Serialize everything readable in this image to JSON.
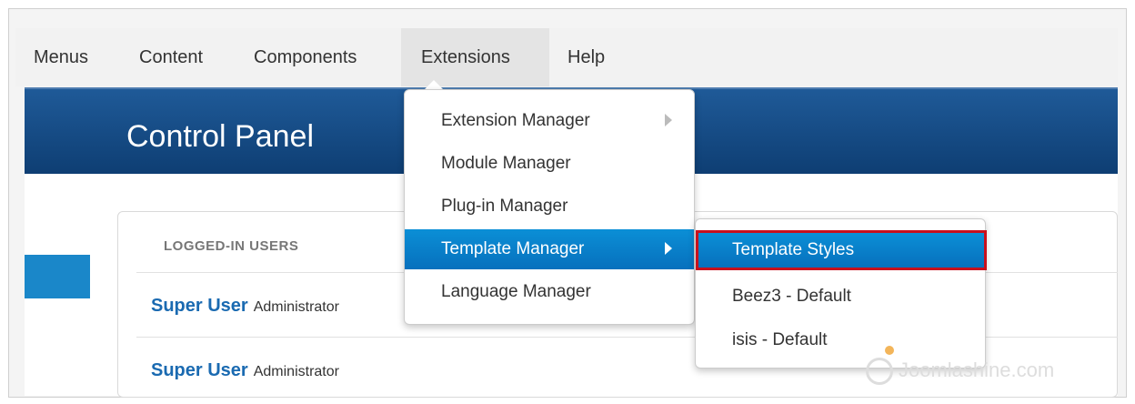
{
  "nav": {
    "items": [
      "Menus",
      "Content",
      "Components",
      "Extensions",
      "Help"
    ],
    "active": "Extensions"
  },
  "header": {
    "title": "Control Panel"
  },
  "panel": {
    "heading": "LOGGED-IN USERS",
    "users": [
      {
        "name": "Super User",
        "role": "Administrator"
      },
      {
        "name": "Super User",
        "role": "Administrator"
      }
    ]
  },
  "dropdown": {
    "items": [
      {
        "label": "Extension Manager",
        "has_submenu": true
      },
      {
        "label": "Module Manager",
        "has_submenu": false
      },
      {
        "label": "Plug-in Manager",
        "has_submenu": false
      },
      {
        "label": "Template Manager",
        "has_submenu": true
      },
      {
        "label": "Language Manager",
        "has_submenu": false
      }
    ],
    "highlighted": "Template Manager"
  },
  "submenu": {
    "items": [
      "Template Styles",
      "Beez3 - Default",
      "isis - Default"
    ],
    "selected": "Template Styles"
  },
  "watermark": {
    "text": "Joomlashine.com",
    "icon": "joomlashine-logo-icon"
  },
  "colors": {
    "header_blue": "#1f5a98",
    "highlight_blue": "#0b8fd6",
    "selection_outline": "#c8101d",
    "username_link": "#1a6ab1"
  }
}
